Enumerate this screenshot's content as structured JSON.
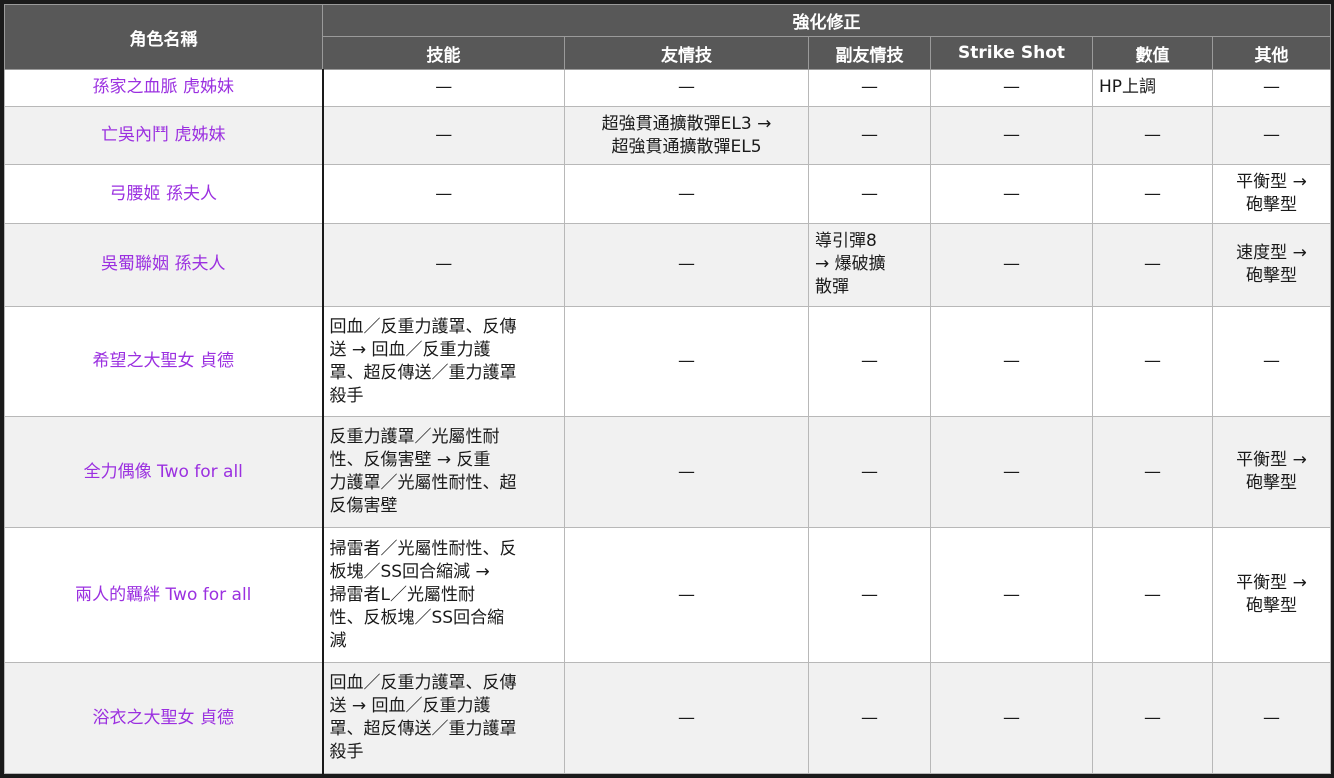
{
  "header": {
    "name_col": "角色名稱",
    "group": "強化修正",
    "cols": [
      "技能",
      "友情技",
      "副友情技",
      "Strike Shot",
      "數值",
      "其他"
    ]
  },
  "rows": [
    {
      "name": "孫家之血脈 虎姊妹",
      "skill": "—",
      "friendship": "—",
      "sub_friendship": "—",
      "strike_shot": "—",
      "stats": "HP上調",
      "other": "—"
    },
    {
      "name": "亡吳內鬥 虎姊妹",
      "skill": "—",
      "friendship": "超強貫通擴散彈EL3 →\n超強貫通擴散彈EL5",
      "sub_friendship": "—",
      "strike_shot": "—",
      "stats": "—",
      "other": "—"
    },
    {
      "name": "弓腰姬 孫夫人",
      "skill": "—",
      "friendship": "—",
      "sub_friendship": "—",
      "strike_shot": "—",
      "stats": "—",
      "other": "平衡型 →\n砲擊型"
    },
    {
      "name": "吳蜀聯姻 孫夫人",
      "skill": "—",
      "friendship": "—",
      "sub_friendship": "導引彈8\n→ 爆破擴\n散彈",
      "strike_shot": "—",
      "stats": "—",
      "other": "速度型 →\n砲擊型"
    },
    {
      "name": "希望之大聖女 貞德",
      "skill": "回血／反重力護罩、反傳\n送 → 回血／反重力護\n罩、超反傳送／重力護罩\n殺手",
      "friendship": "—",
      "sub_friendship": "—",
      "strike_shot": "—",
      "stats": "—",
      "other": "—"
    },
    {
      "name": "全力偶像 Two for all",
      "skill": "反重力護罩／光屬性耐\n性、反傷害壁 → 反重\n力護罩／光屬性耐性、超\n反傷害壁",
      "friendship": "—",
      "sub_friendship": "—",
      "strike_shot": "—",
      "stats": "—",
      "other": "平衡型 →\n砲擊型"
    },
    {
      "name": "兩人的羈絆 Two for all",
      "skill": "掃雷者／光屬性耐性、反\n板塊／SS回合縮減 →\n掃雷者L／光屬性耐\n性、反板塊／SS回合縮\n減",
      "friendship": "—",
      "sub_friendship": "—",
      "strike_shot": "—",
      "stats": "—",
      "other": "平衡型 →\n砲擊型"
    },
    {
      "name": "浴衣之大聖女 貞德",
      "skill": "回血／反重力護罩、反傳\n送 → 回血／反重力護\n罩、超反傳送／重力護罩\n殺手",
      "friendship": "—",
      "sub_friendship": "—",
      "strike_shot": "—",
      "stats": "—",
      "other": "—"
    }
  ]
}
